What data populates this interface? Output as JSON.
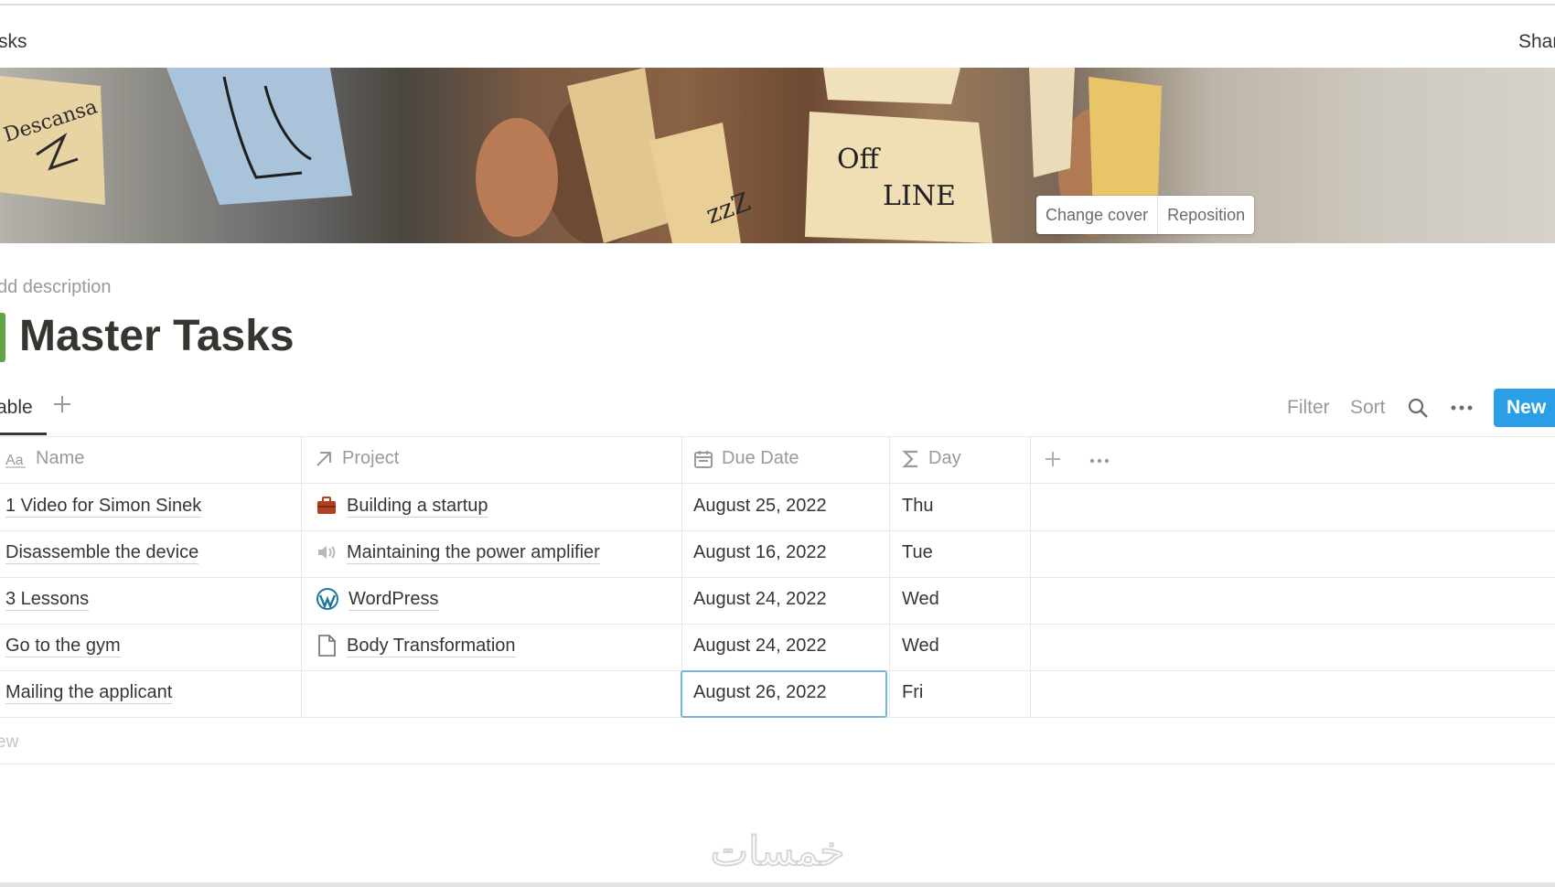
{
  "topbar": {
    "breadcrumb": "sks",
    "share": "Shar"
  },
  "cover": {
    "note_text_1": "Descansa",
    "note_text_2": "Off",
    "note_text_3": "LINE",
    "note_text_4": "zzZ",
    "change_cover": "Change cover",
    "reposition": "Reposition"
  },
  "page": {
    "description": "dd description",
    "title": "Master Tasks",
    "icon_color": "#62a347"
  },
  "toolbar": {
    "view_tab": "able",
    "filter": "Filter",
    "sort": "Sort",
    "new_label": "New",
    "accent": "#2a9ee6"
  },
  "table": {
    "headers": [
      {
        "label": "Name",
        "icon": "text-type-icon"
      },
      {
        "label": "Project",
        "icon": "relation-arrow-icon"
      },
      {
        "label": "Due Date",
        "icon": "calendar-icon"
      },
      {
        "label": "Day",
        "icon": "formula-sigma-icon"
      }
    ],
    "rows": [
      {
        "name": "1 Video for Simon Sinek",
        "project": "Building a startup",
        "project_icon": "briefcase-icon",
        "due": "August 25, 2022",
        "day": "Thu"
      },
      {
        "name": "Disassemble the device",
        "project": "Maintaining the power amplifier",
        "project_icon": "speaker-icon",
        "due": "August 16, 2022",
        "day": "Tue"
      },
      {
        "name": "3 Lessons",
        "project": "WordPress",
        "project_icon": "wordpress-icon",
        "due": "August 24, 2022",
        "day": "Wed"
      },
      {
        "name": "Go to the gym",
        "project": "Body Transformation",
        "project_icon": "document-icon",
        "due": "August 24, 2022",
        "day": "Wed"
      },
      {
        "name": "Mailing the applicant",
        "project": "",
        "project_icon": "",
        "due": "August 26, 2022",
        "day": "Fri"
      }
    ],
    "new_row": "ew"
  },
  "watermark": {
    "text": "خمسات"
  }
}
